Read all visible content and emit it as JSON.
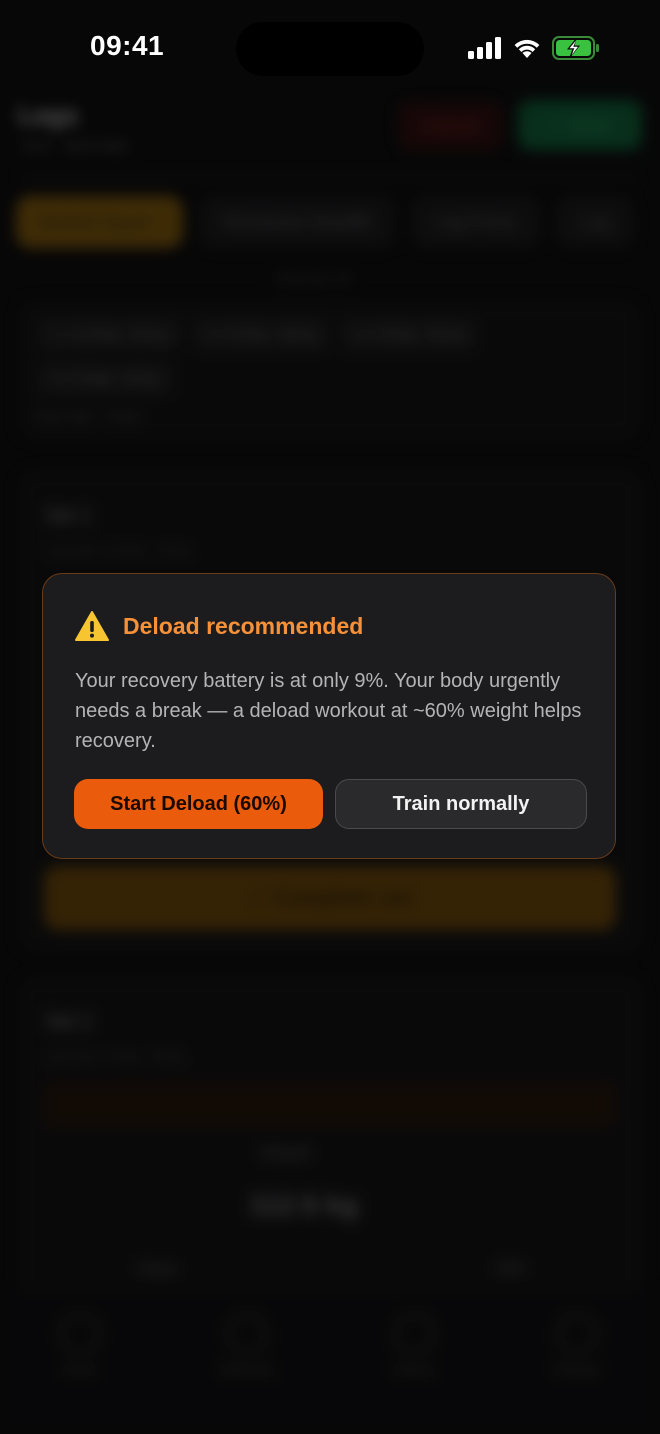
{
  "status_bar": {
    "time": "09:41"
  },
  "background": {
    "title": "Legs",
    "subtitle": "0:21 · 0/24 Sets",
    "cancel_label": "Cancel",
    "done_label": "✓ Done",
    "exercise_chips": [
      "Barbell Squat ›",
      "Romanian Deadlift",
      "Leg Press",
      "Leg"
    ],
    "exercise_caption": "Exercise 1/5",
    "history_pills": [
      "1 × 10 Rep · 80 kg",
      "2 × 8 Rep · 85 kg",
      "3 × 8 Rep · 85 kg",
      "4 × 6 Rep · 90 kg"
    ],
    "history_note": "Rest: 90s · 4 Sets",
    "set1_label": "Set 1",
    "set1_sub": "Last time: 10 Rep · 80 kg",
    "complete_set_label": "✓  Complete set",
    "set2_label": "Set 2",
    "set2_sub": "Last time: 8 Rep · 85 kg",
    "weight_label": "Weight",
    "weight_value": "112.5 kg",
    "reps_label": "Reps",
    "rir_label": "RIR",
    "tabs": [
      "Home",
      "Workouts",
      "History",
      "Settings"
    ]
  },
  "modal": {
    "title": "Deload recommended",
    "body": "Your recovery battery is at only 9%. Your body urgently needs a break — a deload workout at ~60% weight helps recovery.",
    "primary_button": "Start Deload (60%)",
    "secondary_button": "Train normally",
    "accent_color": "#f6913a",
    "primary_color": "#ea5b0c",
    "warning_icon": "warning-triangle-icon"
  }
}
